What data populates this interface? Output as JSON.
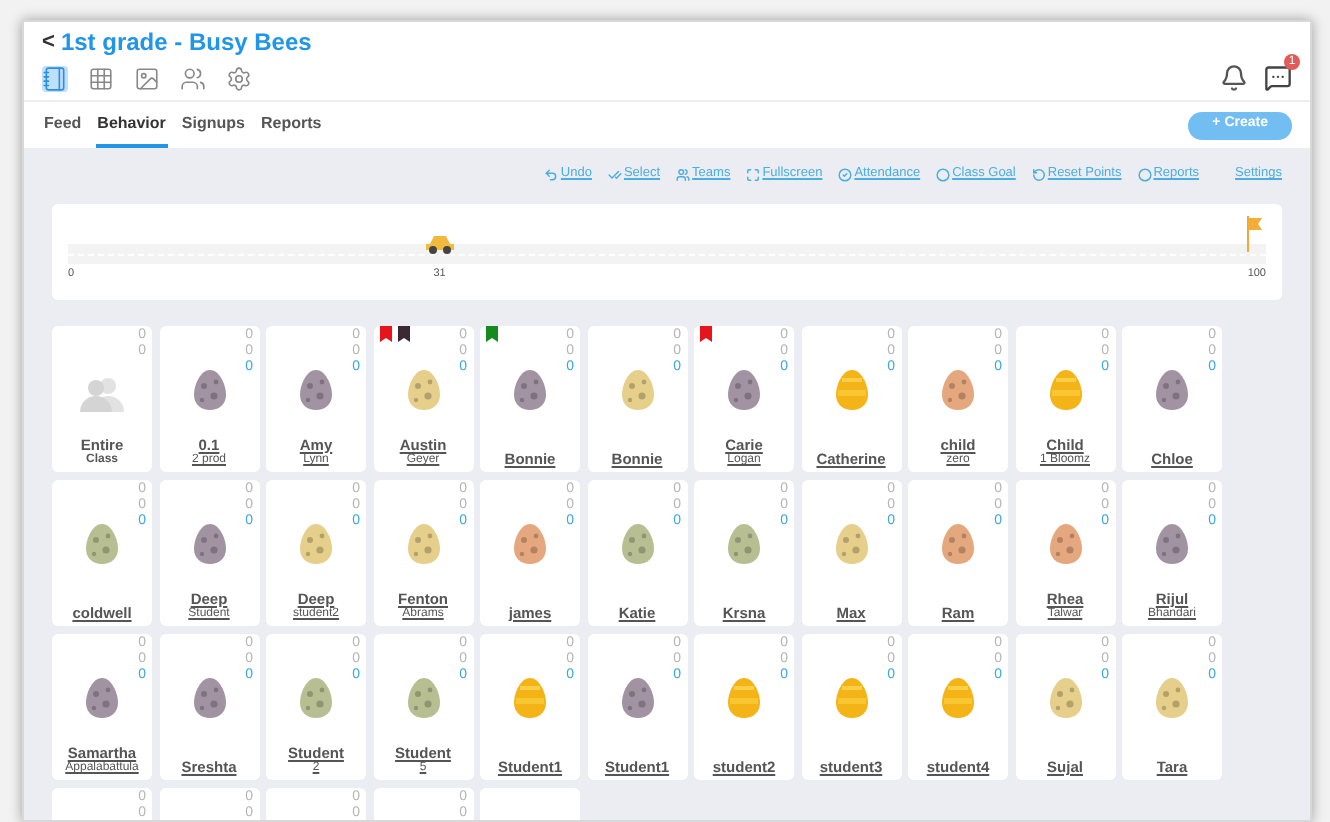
{
  "header": {
    "back": "<",
    "title": "1st grade - Busy Bees",
    "nav_icons": [
      {
        "selected": true
      },
      {
        "selected": false
      },
      {
        "selected": false
      },
      {
        "selected": false
      },
      {
        "selected": false
      }
    ],
    "chat_badge": "1"
  },
  "tabs": [
    {
      "label": "Feed",
      "selected": false
    },
    {
      "label": "Behavior",
      "selected": true
    },
    {
      "label": "Signups",
      "selected": false
    },
    {
      "label": "Reports",
      "selected": false
    }
  ],
  "create_button": "+ Create",
  "toolbar": [
    "Undo",
    "Select",
    "Teams",
    "Fullscreen",
    "Attendance",
    "Class Goal",
    "Reset Points",
    "Reports",
    "Settings"
  ],
  "progress": {
    "level": 0.31,
    "start": "0",
    "current": "31",
    "end": "100"
  },
  "cards": [
    {
      "kind": "class",
      "name": "Entire",
      "sub": "Class",
      "counts": [
        "0",
        "0"
      ]
    },
    {
      "kind": "student",
      "egg": {
        "kind": "spotted",
        "color": "#a293a3"
      },
      "name": "0.1",
      "sub": "2 prod",
      "counts": [
        "0",
        "0",
        "0"
      ]
    },
    {
      "kind": "student",
      "egg": {
        "kind": "spotted",
        "color": "#a293a3"
      },
      "name": "Amy",
      "sub": "Lynn",
      "counts": [
        "0",
        "0",
        "0"
      ]
    },
    {
      "kind": "student",
      "egg": {
        "kind": "spotted",
        "color": "#e6cf8a"
      },
      "name": "Austin",
      "sub": "Geyer",
      "counts": [
        "0",
        "0",
        "0"
      ],
      "flags": [
        {
          "color": "#e8141c"
        },
        {
          "color": "#3b2a33"
        }
      ]
    },
    {
      "kind": "student",
      "egg": {
        "kind": "spotted",
        "color": "#a293a3"
      },
      "name": "Bonnie",
      "counts": [
        "0",
        "0",
        "0"
      ],
      "flags": [
        {
          "color": "#168a1e"
        }
      ]
    },
    {
      "kind": "student",
      "egg": {
        "kind": "spotted",
        "color": "#e6cf8a"
      },
      "name": "Bonnie",
      "counts": [
        "0",
        "0",
        "0"
      ]
    },
    {
      "kind": "student",
      "egg": {
        "kind": "spotted",
        "color": "#a293a3"
      },
      "name": "Carie",
      "sub": "Logan",
      "counts": [
        "0",
        "0",
        "0"
      ],
      "flags": [
        {
          "color": "#e8141c"
        }
      ]
    },
    {
      "kind": "student",
      "egg": {
        "kind": "solid",
        "color": "#f4b417"
      },
      "name": "Catherine",
      "counts": [
        "0",
        "0",
        "0"
      ]
    },
    {
      "kind": "student",
      "egg": {
        "kind": "spotted",
        "color": "#e5a77e"
      },
      "name": "child",
      "sub": "zero",
      "counts": [
        "0",
        "0",
        "0"
      ]
    },
    {
      "kind": "student",
      "egg": {
        "kind": "solid",
        "color": "#f4b417"
      },
      "name": "Child",
      "sub": "1 Bloomz",
      "counts": [
        "0",
        "0",
        "0"
      ]
    },
    {
      "kind": "student",
      "egg": {
        "kind": "spotted",
        "color": "#a293a3"
      },
      "name": "Chloe",
      "counts": [
        "0",
        "0",
        "0"
      ]
    },
    {
      "kind": "student",
      "egg": {
        "kind": "spotted",
        "color": "#b7bf92"
      },
      "name": "coldwell",
      "counts": [
        "0",
        "0",
        "0"
      ]
    },
    {
      "kind": "student",
      "egg": {
        "kind": "spotted",
        "color": "#a293a3"
      },
      "name": "Deep",
      "sub": "Student",
      "counts": [
        "0",
        "0",
        "0"
      ]
    },
    {
      "kind": "student",
      "egg": {
        "kind": "spotted",
        "color": "#e6cf8a"
      },
      "name": "Deep",
      "sub": "student2",
      "counts": [
        "0",
        "0",
        "0"
      ]
    },
    {
      "kind": "student",
      "egg": {
        "kind": "spotted",
        "color": "#e6cf8a"
      },
      "name": "Fenton",
      "sub": "Abrams",
      "counts": [
        "0",
        "0",
        "0"
      ]
    },
    {
      "kind": "student",
      "egg": {
        "kind": "spotted",
        "color": "#e5a77e"
      },
      "name": "james",
      "counts": [
        "0",
        "0",
        "0"
      ]
    },
    {
      "kind": "student",
      "egg": {
        "kind": "spotted",
        "color": "#b7bf92"
      },
      "name": "Katie",
      "counts": [
        "0",
        "0",
        "0"
      ]
    },
    {
      "kind": "student",
      "egg": {
        "kind": "spotted",
        "color": "#b7bf92"
      },
      "name": "Krsna",
      "counts": [
        "0",
        "0",
        "0"
      ]
    },
    {
      "kind": "student",
      "egg": {
        "kind": "spotted",
        "color": "#e6cf8a"
      },
      "name": "Max",
      "counts": [
        "0",
        "0",
        "0"
      ]
    },
    {
      "kind": "student",
      "egg": {
        "kind": "spotted",
        "color": "#e5a77e"
      },
      "name": "Ram",
      "counts": [
        "0",
        "0",
        "0"
      ]
    },
    {
      "kind": "student",
      "egg": {
        "kind": "spotted",
        "color": "#e5a77e"
      },
      "name": "Rhea",
      "sub": "Talwar",
      "counts": [
        "0",
        "0",
        "0"
      ]
    },
    {
      "kind": "student",
      "egg": {
        "kind": "spotted",
        "color": "#a293a3"
      },
      "name": "Rijul",
      "sub": "Bhandari",
      "counts": [
        "0",
        "0",
        "0"
      ]
    },
    {
      "kind": "student",
      "egg": {
        "kind": "spotted",
        "color": "#a293a3"
      },
      "name": "Samartha",
      "sub": "Appalabattula",
      "counts": [
        "0",
        "0",
        "0"
      ]
    },
    {
      "kind": "student",
      "egg": {
        "kind": "spotted",
        "color": "#a293a3"
      },
      "name": "Sreshta",
      "counts": [
        "0",
        "0",
        "0"
      ]
    },
    {
      "kind": "student",
      "egg": {
        "kind": "spotted",
        "color": "#b7bf92"
      },
      "name": "Student",
      "sub": "2",
      "counts": [
        "0",
        "0",
        "0"
      ]
    },
    {
      "kind": "student",
      "egg": {
        "kind": "spotted",
        "color": "#b7bf92"
      },
      "name": "Student",
      "sub": "5",
      "counts": [
        "0",
        "0",
        "0"
      ]
    },
    {
      "kind": "student",
      "egg": {
        "kind": "solid",
        "color": "#f4b417"
      },
      "name": "Student1",
      "counts": [
        "0",
        "0",
        "0"
      ]
    },
    {
      "kind": "student",
      "egg": {
        "kind": "spotted",
        "color": "#a293a3"
      },
      "name": "Student1",
      "counts": [
        "0",
        "0",
        "0"
      ]
    },
    {
      "kind": "student",
      "egg": {
        "kind": "solid",
        "color": "#f4b417"
      },
      "name": "student2",
      "counts": [
        "0",
        "0",
        "0"
      ]
    },
    {
      "kind": "student",
      "egg": {
        "kind": "solid",
        "color": "#f4b417"
      },
      "name": "student3",
      "counts": [
        "0",
        "0",
        "0"
      ]
    },
    {
      "kind": "student",
      "egg": {
        "kind": "solid",
        "color": "#f4b417"
      },
      "name": "student4",
      "counts": [
        "0",
        "0",
        "0"
      ]
    },
    {
      "kind": "student",
      "egg": {
        "kind": "spotted",
        "color": "#e6cf8a"
      },
      "name": "Sujal",
      "counts": [
        "0",
        "0",
        "0"
      ]
    },
    {
      "kind": "student",
      "egg": {
        "kind": "spotted",
        "color": "#e6cf8a"
      },
      "name": "Tara",
      "counts": [
        "0",
        "0",
        "0"
      ]
    },
    {
      "kind": "partial",
      "counts": [
        "0",
        "0"
      ]
    },
    {
      "kind": "partial",
      "counts": [
        "0",
        "0"
      ]
    },
    {
      "kind": "partial",
      "counts": [
        "0",
        "0"
      ]
    },
    {
      "kind": "partial",
      "counts": [
        "0",
        "0"
      ]
    },
    {
      "kind": "blank"
    }
  ]
}
